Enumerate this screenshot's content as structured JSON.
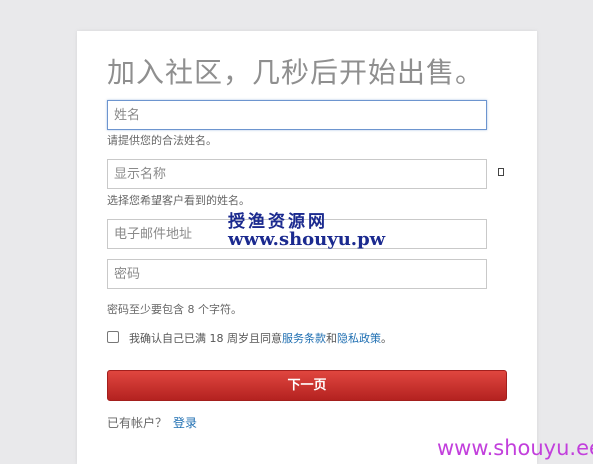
{
  "form": {
    "heading": "加入社区，几秒后开始出售。",
    "name_field": {
      "placeholder": "姓名",
      "hint": "请提供您的合法姓名。"
    },
    "display_name_field": {
      "placeholder": "显示名称",
      "hint": "选择您希望客户看到的姓名。"
    },
    "email_field": {
      "placeholder": "电子邮件地址"
    },
    "password_field": {
      "placeholder": "密码",
      "hint": "密码至少要包含 8 个字符。"
    },
    "consent": {
      "prefix": "我确认自己已满 18 周岁且同意",
      "terms_link": "服务条款",
      "and": "和",
      "privacy_link": "隐私政策",
      "suffix": "。",
      "checked": false
    },
    "next_button": "下一页",
    "login": {
      "prompt": "已有帐户？",
      "link": "登录"
    }
  },
  "watermark": {
    "chinese": "授渔资源网",
    "url": "www.shouyu.pw",
    "corner_url": "www.shouyu.ee"
  }
}
